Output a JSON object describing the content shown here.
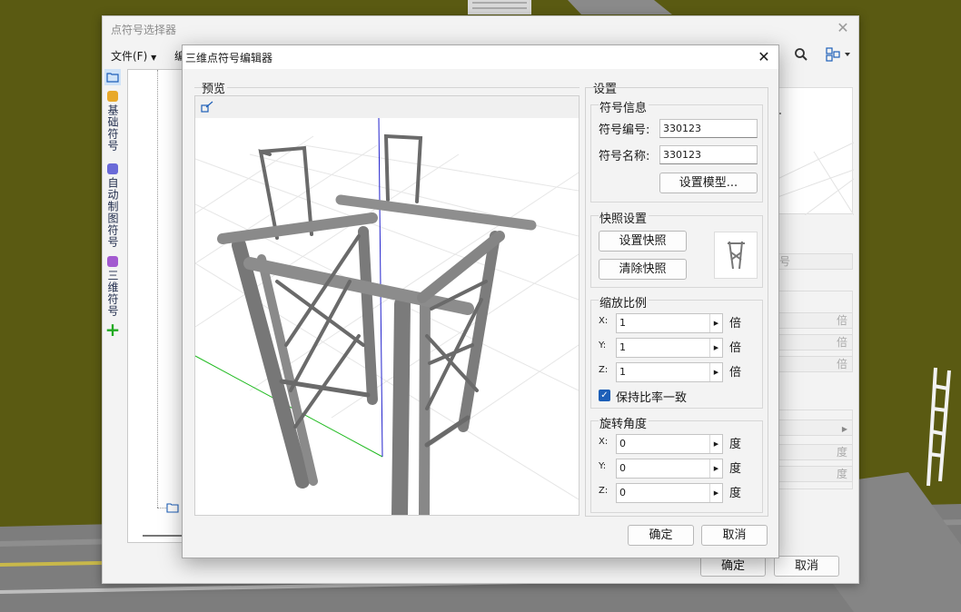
{
  "background_dialog": {
    "title": "点符号选择器",
    "menu_file": "文件(F)",
    "menu_edit_partial": "编",
    "side_tabs": [
      "基础符号",
      "自动制图符号",
      "三维符号"
    ],
    "right_label_partial": "号",
    "scale_units": [
      "倍",
      "倍",
      "倍"
    ],
    "rotation_units": [
      "度",
      "度"
    ],
    "ok_label": "确定",
    "cancel_label": "取消"
  },
  "dialog": {
    "title": "三维点符号编辑器",
    "preview_caption": "预览",
    "settings_caption": "设置",
    "symbol_info": {
      "caption": "符号信息",
      "id_label": "符号编号:",
      "id_value": "330123",
      "name_label": "符号名称:",
      "name_value": "330123",
      "model_button": "设置模型..."
    },
    "snapshot": {
      "caption": "快照设置",
      "set_button": "设置快照",
      "clear_button": "清除快照"
    },
    "scale": {
      "caption": "缩放比例",
      "x_label": "X:",
      "x_value": "1",
      "y_label": "Y:",
      "y_value": "1",
      "z_label": "Z:",
      "z_value": "1",
      "unit": "倍",
      "keep_ratio_label": "保持比率一致",
      "keep_ratio_checked": true
    },
    "rotation": {
      "caption": "旋转角度",
      "x_label": "X:",
      "x_value": "0",
      "y_label": "Y:",
      "y_value": "0",
      "z_label": "Z:",
      "z_value": "0",
      "unit": "度"
    },
    "ok_label": "确定",
    "cancel_label": "取消"
  },
  "colors": {
    "terrain": "#5a5a12",
    "accent": "#1d5fb8",
    "axis_x": "#22bb22",
    "axis_z": "#2222cc"
  }
}
